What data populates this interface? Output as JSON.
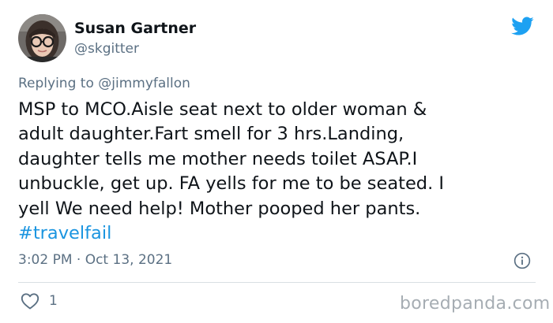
{
  "author": {
    "name": "Susan Gartner",
    "handle": "@skgitter",
    "avatar_icon": "profile-photo-avatar"
  },
  "reply": {
    "prefix": "Replying to",
    "mention": "@jimmyfallon"
  },
  "tweet": {
    "lines": [
      "MSP to MCO.Aisle seat next to older woman &",
      "adult daughter.Fart smell for 3 hrs.Landing,",
      "daughter tells me mother needs toilet ASAP.I",
      "unbuckle, get up. FA yells for me to be seated. I",
      "yell We need help! Mother pooped her pants."
    ],
    "hashtag": "#travelfail"
  },
  "meta": {
    "timestamp": "3:02 PM · Oct 13, 2021"
  },
  "actions": {
    "like_count": "1"
  },
  "watermark": "boredpanda.com",
  "colors": {
    "twitter_blue": "#1da1f2",
    "hashtag_blue": "#1b95e0",
    "secondary_text": "#5b7083",
    "primary_text": "#0f1419",
    "divider": "#d9dfe3",
    "watermark": "#a6adb3"
  },
  "icons": {
    "brand": "twitter-bird-icon",
    "info": "info-icon",
    "like": "heart-icon"
  }
}
